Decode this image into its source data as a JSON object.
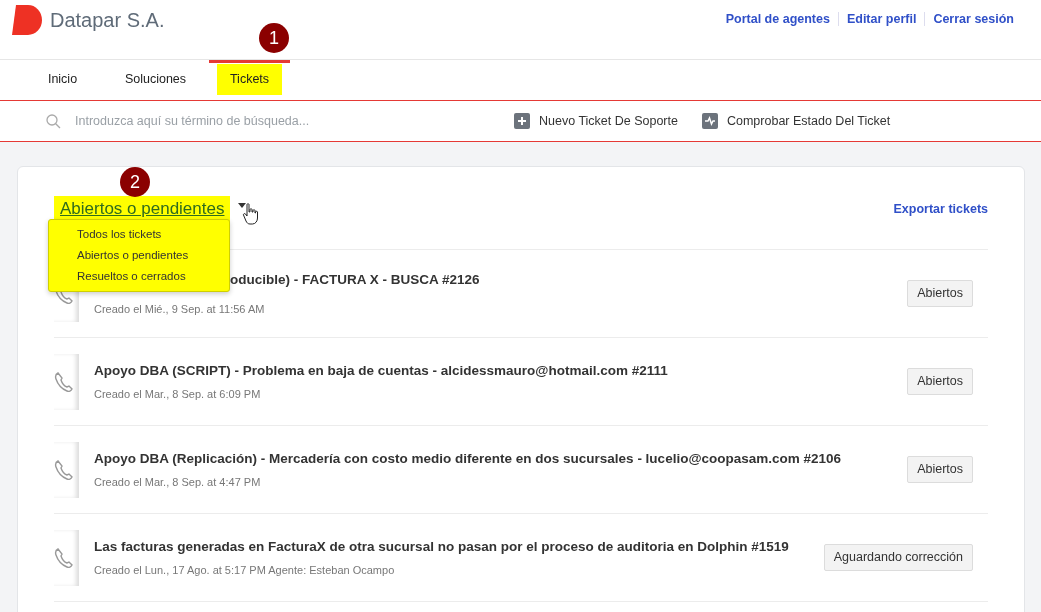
{
  "header": {
    "brand": "Datapar S.A.",
    "links": [
      "Portal de agentes",
      "Editar perfil",
      "Cerrar sesión"
    ]
  },
  "nav": {
    "marker": "1",
    "tabs": [
      {
        "label": "Inicio",
        "selected": false,
        "highlighted": false
      },
      {
        "label": "Soluciones",
        "selected": false,
        "highlighted": false
      },
      {
        "label": "Tickets",
        "selected": true,
        "highlighted": true
      }
    ]
  },
  "search": {
    "placeholder": "Introduzca aquí su término de búsqueda..."
  },
  "actions": [
    {
      "label": "Nuevo Ticket De Soporte",
      "kind": "new"
    },
    {
      "label": "Comprobar Estado Del Ticket",
      "kind": "status"
    }
  ],
  "tickets_panel": {
    "filter": {
      "label": "Abiertos o pendientes",
      "highlighted": true,
      "marker": "2",
      "expanded": true,
      "options": [
        "Todos los tickets",
        "Abiertos o pendientes",
        "Resueltos o cerrados"
      ]
    },
    "export_link": "Exportar tickets",
    "tickets": [
      {
        "title": "oducible) - FACTURA X - BUSCA #2126",
        "meta": "Creado el Mié., 9 Sep. at 11:56 AM",
        "status": "Abiertos"
      },
      {
        "title": "Apoyo DBA (SCRIPT) - Problema en baja de cuentas - alcidessmauro@hotmail.com #2111",
        "meta": "Creado el Mar., 8 Sep. at 6:09 PM",
        "status": "Abiertos"
      },
      {
        "title": "Apoyo DBA (Replicación) - Mercadería con costo medio diferente en dos sucursales - lucelio@coopasam.com #2106",
        "meta": "Creado el Mar., 8 Sep. at 4:47 PM",
        "status": "Abiertos"
      },
      {
        "title": "Las facturas generadas en FacturaX de otra sucursal no pasan por el proceso de auditoria en Dolphin #1519",
        "meta": "Creado el Lun., 17 Ago. at 5:17 PM Agente: Esteban Ocampo",
        "status": "Aguardando corrección"
      }
    ]
  }
}
